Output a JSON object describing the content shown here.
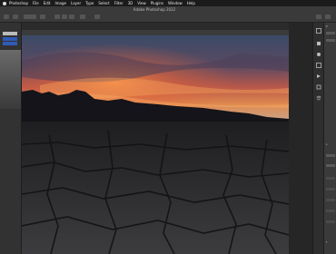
{
  "menu": {
    "items": [
      "Photoshop",
      "File",
      "Edit",
      "Image",
      "Layer",
      "Type",
      "Select",
      "Filter",
      "3D",
      "View",
      "Plugins",
      "Window",
      "Help"
    ],
    "app_name_visible": "Adobe Photoshop 2022"
  },
  "document": {
    "title": "Adobe Photoshop 2022"
  },
  "colors": {
    "accent_blue": "#2f5bb7",
    "panel_dark": "#323232",
    "background": "#2a2a2a"
  },
  "right_panel": {
    "labels": [
      "P",
      "L",
      "f"
    ]
  }
}
